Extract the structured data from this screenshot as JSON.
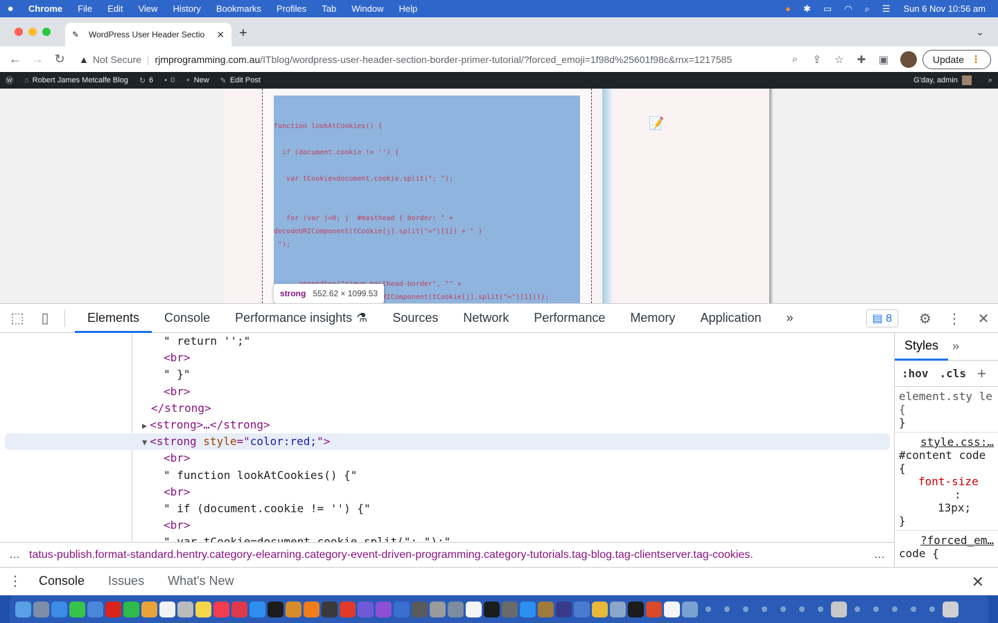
{
  "menubar": {
    "apple": "",
    "items": [
      "Chrome",
      "File",
      "Edit",
      "View",
      "History",
      "Bookmarks",
      "Profiles",
      "Tab",
      "Window",
      "Help"
    ],
    "clock": "Sun 6 Nov  10:56 am"
  },
  "browser": {
    "tab_title": "WordPress User Header Sectio",
    "new_tab": "+",
    "not_secure": "Not Secure",
    "url_domain": "rjmprogramming.com.au",
    "url_path": "/ITblog/wordpress-user-header-section-border-primer-tutorial/?forced_emoji=1f98d%25601f98c&rnx=1217585",
    "update_label": "Update"
  },
  "wpbar": {
    "site_name": "Robert James Metcalfe Blog",
    "updates_count": "6",
    "comments_count": "0",
    "new_label": "New",
    "edit_post_label": "Edit Post",
    "greeting": "G'day, admin"
  },
  "page": {
    "code_lines": [
      "function lookAtCookies() {",
      "",
      "  if (document.cookie != '') {",
      "",
      "   var tCookie=document.cookie.split(\"; \");",
      "",
      "",
      "   for (var j=0; j  #masthead { border: \" +",
      "decodeURIComponent(tCookie[j].split(\"=\")[1]) + \" }",
      " \");",
      "",
      "",
      "      appendtoa(\"rjmwp_masthead-border\", \"\" +",
      "encodeURIComponent(decodeURIComponent(tCookie[j].split(\"=\")[1])));"
    ],
    "tooltip_tag": "strong",
    "tooltip_dims": "552.62 × 1099.53"
  },
  "devtools": {
    "tabs": [
      "Elements",
      "Console",
      "Performance insights",
      "Sources",
      "Network",
      "Performance",
      "Memory",
      "Application"
    ],
    "more_tabs": "»",
    "issues_count": "8",
    "tree": [
      {
        "indent": 236,
        "type": "text",
        "text": "\" return '';\""
      },
      {
        "indent": 236,
        "type": "tag",
        "text": "<br>"
      },
      {
        "indent": 236,
        "type": "text",
        "text": "\" }\""
      },
      {
        "indent": 236,
        "type": "tag",
        "text": "<br>"
      },
      {
        "indent": 218,
        "type": "tag",
        "text": "</strong>"
      },
      {
        "indent": 205,
        "type": "collapsed",
        "arrow": "▶",
        "text": "<strong>…</strong>"
      },
      {
        "indent": 205,
        "type": "expanded",
        "arrow": "▼",
        "open": "<strong ",
        "attr": "style",
        "eq": "=\"",
        "value": "color:red;",
        "close": "\">"
      },
      {
        "indent": 236,
        "type": "tag",
        "text": "<br>"
      },
      {
        "indent": 236,
        "type": "text",
        "text": "\" function lookAtCookies() {\""
      },
      {
        "indent": 236,
        "type": "tag",
        "text": "<br>"
      },
      {
        "indent": 236,
        "type": "text",
        "text": "\" if (document.cookie != '') {\""
      },
      {
        "indent": 236,
        "type": "tag",
        "text": "<br>"
      },
      {
        "indent": 236,
        "type": "text",
        "text": "\" var tCookie=document.cookie.split(\"; \");\""
      }
    ],
    "breadcrumb": "tatus-publish.format-standard.hentry.category-elearning.category-event-driven-programming.category-tutorials.tag-blog.tag-clientserver.tag-cookies.",
    "styles": {
      "tab_label": "Styles",
      "hov": ":hov",
      "cls": ".cls",
      "rule1_selector": "element.sty le {",
      "rule1_close": "}",
      "rule2_source": "style.css:…",
      "rule2_selector": "#content code {",
      "rule2_prop": "font-size",
      "rule2_colon": ":",
      "rule2_value": "13px;",
      "rule2_close": "}",
      "rule3_source": "?forced_em…",
      "rule3_selector": "code {"
    },
    "drawer_tabs": [
      "Console",
      "Issues",
      "What's New"
    ]
  },
  "dock": {
    "colors": [
      "#5aa0e8",
      "#7e8ea8",
      "#3b8be8",
      "#39c24a",
      "#4a86d9",
      "#d9241b",
      "#2dbb49",
      "#e8a33a",
      "#f2f2f2",
      "#bbbbbb",
      "#f5d54a",
      "#f23c50",
      "#e0384b",
      "#2e8ff0",
      "#1c1c1c",
      "#d68b2a",
      "#f07d1a",
      "#3a3a3a",
      "#e03a2a",
      "#6e5ad9",
      "#8d4fd6",
      "#3a6fd0",
      "#5a5a5a",
      "#9a9a9a",
      "#7a8ea0",
      "#f5f5f5",
      "#1c1c1c",
      "#6a6a6a",
      "#2d8ff0",
      "#a07a3a",
      "#3a3a8a",
      "#4a7ad0",
      "#e8b83a",
      "#8aa6c8",
      "#1c1c1c",
      "#d84a2a",
      "#f5f5f5",
      "#7aa2d0",
      "#7aa2d0",
      "#7aa2d0",
      "#7aa2d0",
      "#7aa2d0",
      "#7aa2d0",
      "#7aa2d0",
      "#7aa2d0",
      "#c8c8c8",
      "#7aa2d0",
      "#7aa2d0",
      "#7aa2d0",
      "#7aa2d0",
      "#7aa2d0",
      "#d0d0d0"
    ]
  }
}
